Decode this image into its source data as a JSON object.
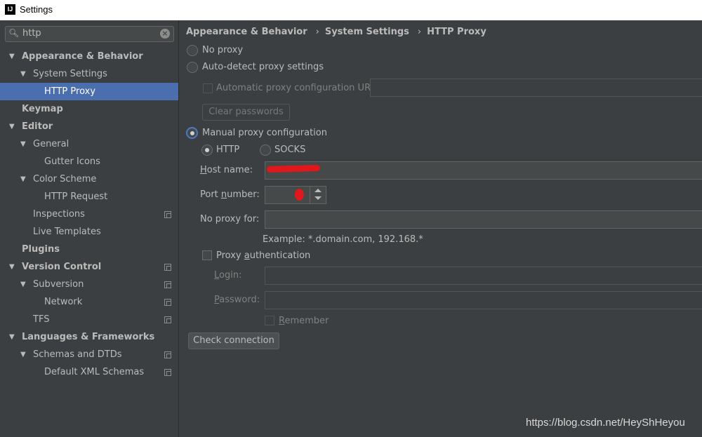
{
  "window": {
    "title": "Settings",
    "logo_text": "IJ"
  },
  "search": {
    "value": "http"
  },
  "tree": [
    {
      "label": "Appearance & Behavior",
      "level": 0,
      "expanded": true,
      "bold": true,
      "selected": false,
      "project": false
    },
    {
      "label": "System Settings",
      "level": 1,
      "expanded": true,
      "bold": false,
      "selected": false,
      "project": false
    },
    {
      "label": "HTTP Proxy",
      "level": 2,
      "expanded": null,
      "bold": false,
      "selected": true,
      "project": false
    },
    {
      "label": "Keymap",
      "level": 0,
      "expanded": null,
      "bold": true,
      "selected": false,
      "project": false
    },
    {
      "label": "Editor",
      "level": 0,
      "expanded": true,
      "bold": true,
      "selected": false,
      "project": false
    },
    {
      "label": "General",
      "level": 1,
      "expanded": true,
      "bold": false,
      "selected": false,
      "project": false
    },
    {
      "label": "Gutter Icons",
      "level": 2,
      "expanded": null,
      "bold": false,
      "selected": false,
      "project": false
    },
    {
      "label": "Color Scheme",
      "level": 1,
      "expanded": true,
      "bold": false,
      "selected": false,
      "project": false
    },
    {
      "label": "HTTP Request",
      "level": 2,
      "expanded": null,
      "bold": false,
      "selected": false,
      "project": false
    },
    {
      "label": "Inspections",
      "level": 1,
      "expanded": null,
      "bold": false,
      "selected": false,
      "project": true
    },
    {
      "label": "Live Templates",
      "level": 1,
      "expanded": null,
      "bold": false,
      "selected": false,
      "project": false
    },
    {
      "label": "Plugins",
      "level": 0,
      "expanded": null,
      "bold": true,
      "selected": false,
      "project": false
    },
    {
      "label": "Version Control",
      "level": 0,
      "expanded": true,
      "bold": true,
      "selected": false,
      "project": true
    },
    {
      "label": "Subversion",
      "level": 1,
      "expanded": true,
      "bold": false,
      "selected": false,
      "project": true
    },
    {
      "label": "Network",
      "level": 2,
      "expanded": null,
      "bold": false,
      "selected": false,
      "project": true
    },
    {
      "label": "TFS",
      "level": 1,
      "expanded": null,
      "bold": false,
      "selected": false,
      "project": true
    },
    {
      "label": "Languages & Frameworks",
      "level": 0,
      "expanded": true,
      "bold": true,
      "selected": false,
      "project": false
    },
    {
      "label": "Schemas and DTDs",
      "level": 1,
      "expanded": true,
      "bold": false,
      "selected": false,
      "project": true
    },
    {
      "label": "Default XML Schemas",
      "level": 2,
      "expanded": null,
      "bold": false,
      "selected": false,
      "project": true
    }
  ],
  "breadcrumb": [
    "Appearance & Behavior",
    "System Settings",
    "HTTP Proxy"
  ],
  "proxy": {
    "no_proxy": "No proxy",
    "auto_detect": "Auto-detect proxy settings",
    "auto_config_url": "Automatic proxy configuration URL:",
    "clear_passwords": "Clear passwords",
    "manual": "Manual proxy configuration",
    "selected_mode": "Manual proxy configuration",
    "http": "HTTP",
    "socks": "SOCKS",
    "selected_type": "HTTP",
    "host_label_prefix": "H",
    "host_label_rest": "ost name:",
    "port_label_prefix": "Port ",
    "port_label_u": "n",
    "port_label_rest": "umber:",
    "no_proxy_for": "No proxy for:",
    "example": "Example: *.domain.com, 192.168.*",
    "proxy_auth_prefix": "Proxy ",
    "proxy_auth_u": "a",
    "proxy_auth_rest": "uthentication",
    "login_u": "L",
    "login_rest": "ogin:",
    "password_u": "P",
    "password_rest": "assword:",
    "remember_u": "R",
    "remember_rest": "emember",
    "check_connection": "Check connection"
  },
  "watermark": "https://blog.csdn.net/HeyShHeyou",
  "colors": {
    "background": "#3c3f41",
    "selection": "#4b6eaf",
    "redaction": "#e0181c"
  }
}
